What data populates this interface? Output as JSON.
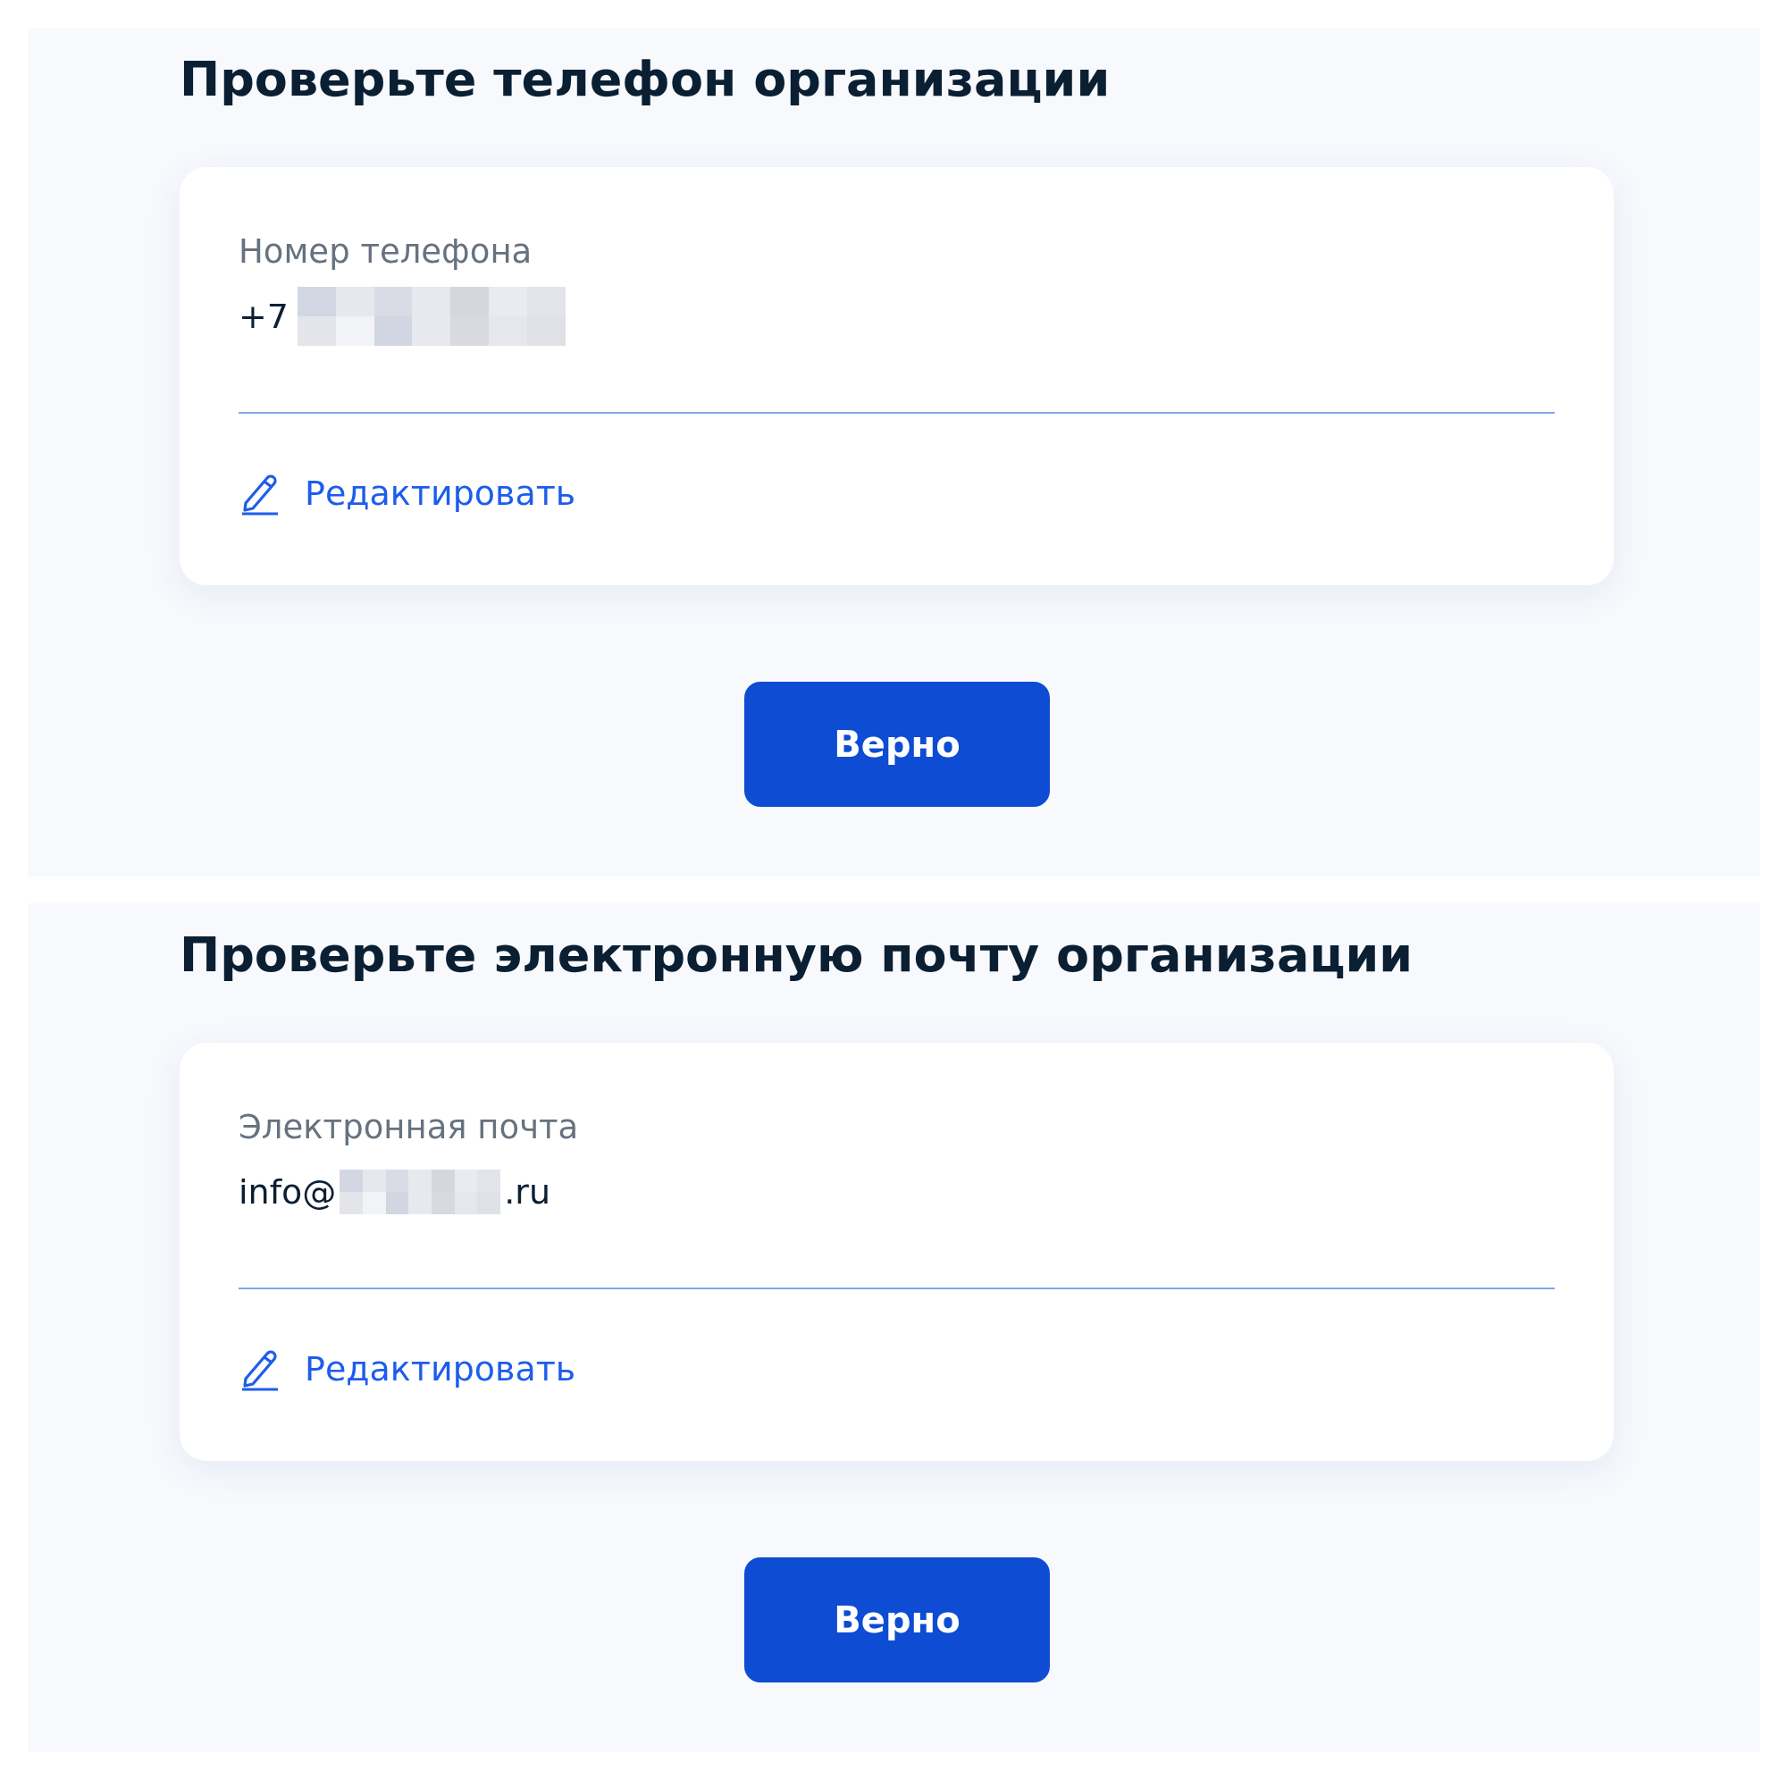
{
  "sections": [
    {
      "title": "Проверьте телефон организации",
      "field": {
        "label": "Номер телефона",
        "value_start": "+7"
      },
      "edit_link": "Редактировать",
      "confirm_button": "Верно"
    },
    {
      "title": "Проверьте электронную почту организации",
      "field": {
        "label": "Электронная почта",
        "value_start": "info@",
        "value_end": ".ru"
      },
      "edit_link": "Редактировать",
      "confirm_button": "Верно"
    }
  ]
}
